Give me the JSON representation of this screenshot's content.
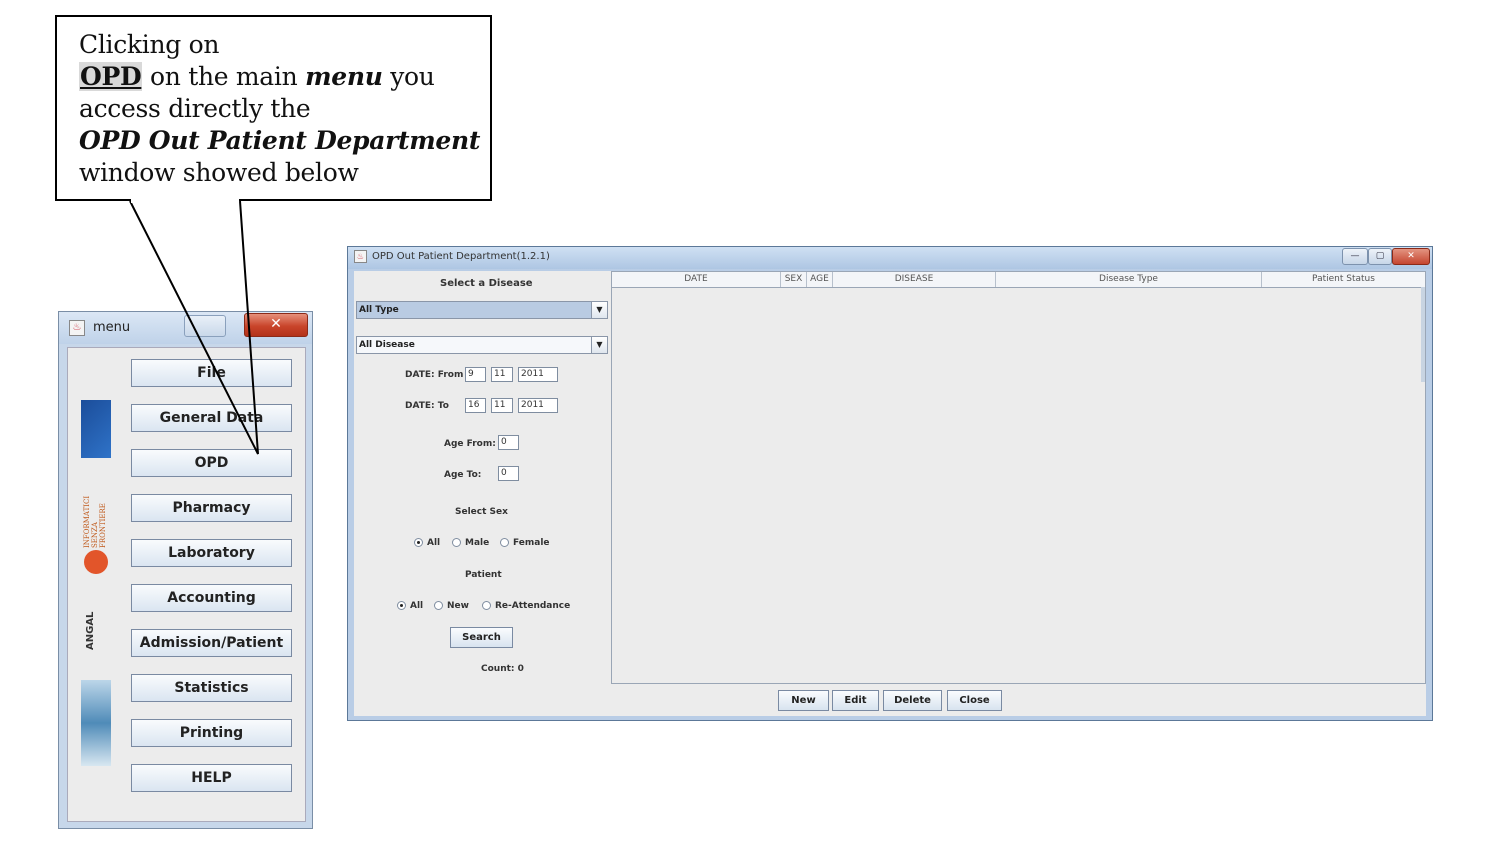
{
  "callout": {
    "line1": "Clicking on",
    "opd_word": "OPD",
    "line2_mid": " on the main ",
    "menu_word": "menu",
    "line2_end": " you",
    "line3": "access directly the",
    "line4": "OPD Out Patient Department",
    "line5": "window showed below"
  },
  "menu_window": {
    "title": "menu",
    "close_glyph": "✕",
    "logo_text_2": "INFORMATICI SENZA FRONTIERE",
    "logo_text_4": "ANGAL",
    "buttons": [
      "File",
      "General Data",
      "OPD",
      "Pharmacy",
      "Laboratory",
      "Accounting",
      "Admission/Patient",
      "Statistics",
      "Printing",
      "HELP"
    ]
  },
  "opd_window": {
    "title": "OPD Out Patient Department(1.2.1)",
    "controls": {
      "min": "—",
      "max": "▢",
      "close": "✕"
    },
    "select_disease_label": "Select a Disease",
    "disease_type_combo": "All Type",
    "disease_combo": "All Disease",
    "date_from_label": "DATE: From",
    "date_from": {
      "day": "9",
      "month": "11",
      "year": "2011"
    },
    "date_to_label": "DATE: To",
    "date_to": {
      "day": "16",
      "month": "11",
      "year": "2011"
    },
    "age_from_label": "Age From:",
    "age_from": "0",
    "age_to_label": "Age To:",
    "age_to": "0",
    "select_sex_label": "Select Sex",
    "sex_options": [
      "All",
      "Male",
      "Female"
    ],
    "sex_selected": "All",
    "patient_label": "Patient",
    "patient_options": [
      "All",
      "New",
      "Re-Attendance"
    ],
    "patient_selected": "All",
    "search_button": "Search",
    "count_text": "Count: 0",
    "table_columns": [
      "DATE",
      "SEX",
      "AGE",
      "DISEASE",
      "Disease Type",
      "Patient Status"
    ],
    "footer_buttons": [
      "New",
      "Edit",
      "Delete",
      "Close"
    ]
  }
}
